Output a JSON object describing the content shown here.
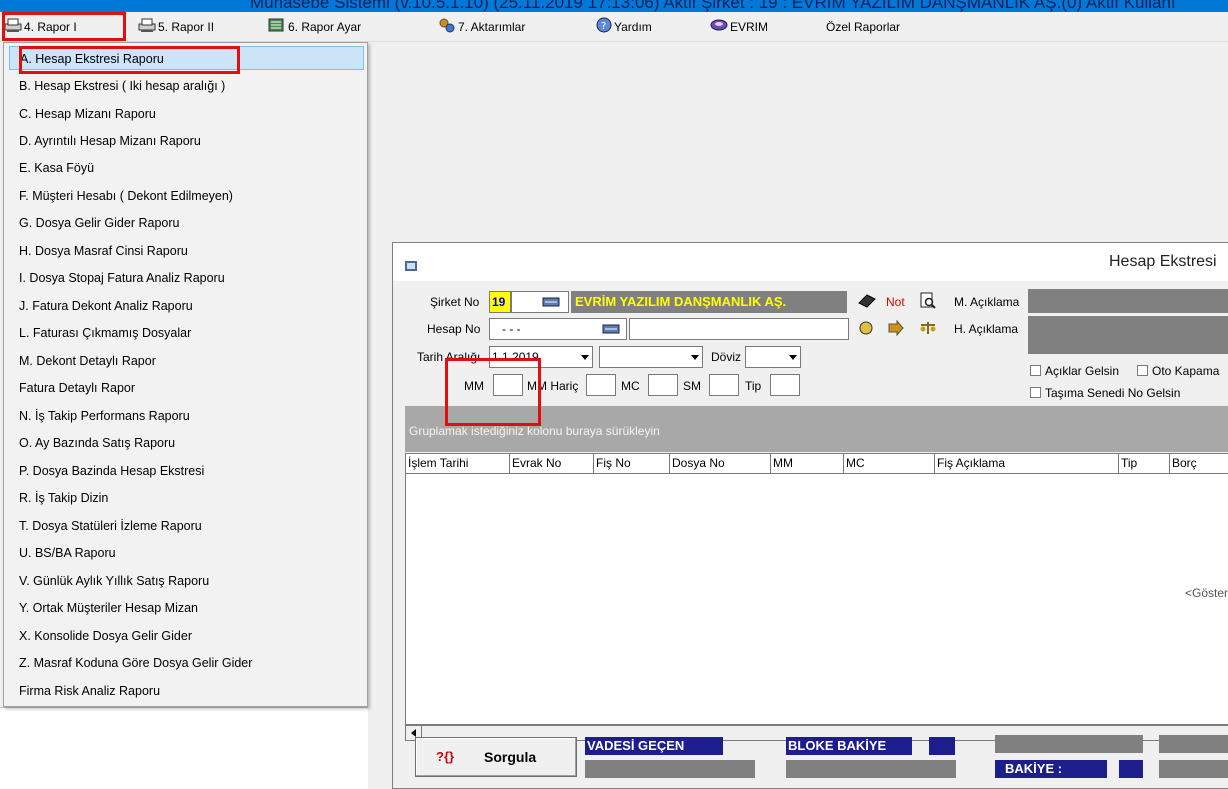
{
  "app": {
    "title": "Muhasebe Sistemi (v.10.5.1.10) (25.11.2019 17:13:06) Aktif Şirket : 19 : EVRIM YAZILIM DANŞMANLIK AŞ.(0) Aktif Kullanı"
  },
  "menubar": {
    "items": [
      {
        "label": "4.  Rapor I",
        "icon": "printer-icon"
      },
      {
        "label": "5.  Rapor II",
        "icon": "printer-icon"
      },
      {
        "label": "6.  Rapor Ayar",
        "icon": "report-settings-icon"
      },
      {
        "label": "7.  Aktarımlar",
        "icon": "transfer-icon"
      },
      {
        "label": "Yardım",
        "icon": "help-icon"
      },
      {
        "label": "EVRIM",
        "icon": "evrim-logo-icon"
      },
      {
        "label": "Özel Raporlar",
        "icon": ""
      }
    ]
  },
  "dropdown": {
    "items": [
      "A.  Hesap Ekstresi Raporu",
      "B.  Hesap Ekstresi ( Iki hesap aralığı )",
      "C.  Hesap Mizanı Raporu",
      "D.  Ayrıntılı Hesap Mizanı Raporu",
      "E.  Kasa Föyü",
      "F.  Müşteri Hesabı ( Dekont Edilmeyen)",
      "G.  Dosya Gelir Gider Raporu",
      "H.  Dosya Masraf Cinsi Raporu",
      "I.  Dosya Stopaj Fatura Analiz Raporu",
      "J.  Fatura Dekont Analiz Raporu",
      "L.  Faturası Çıkmamış Dosyalar",
      "M.   Dekont Detaylı Rapor",
      "       Fatura Detaylı Rapor",
      "N.  İş Takip Performans Raporu",
      "O.  Ay Bazında Satış Raporu",
      "P.  Dosya Bazinda Hesap Ekstresi",
      "R.  İş Takip Dizin",
      "T.  Dosya Statüleri İzleme Raporu",
      "U.  BS/BA Raporu",
      "V. Günlük Aylık Yıllık Satış Raporu",
      "Y. Ortak Müşteriler Hesap Mizan",
      "X. Konsolide Dosya Gelir Gider",
      "Z. Masraf Koduna Göre Dosya Gelir Gider",
      "     Firma Risk Analiz Raporu"
    ],
    "selected_index": 0
  },
  "window": {
    "title": "Hesap Ekstresi",
    "sirket_no_label": "Şirket No",
    "sirket_no_value": "19",
    "company_name": "EVRİM YAZILIM DANŞMANLIK AŞ.",
    "not_label": "Not",
    "m_aciklama_label": "M. Açıklama",
    "hesap_no_label": "Hesap No",
    "hesap_no_value": "- - -",
    "h_aciklama_label": "H. Açıklama",
    "tarih_araligi_label": "Tarih Aralığı",
    "tarih_start": "1.1.2019",
    "doviz_label": "Döviz",
    "mm_label": "MM",
    "mm_haric_label": "MM Hariç",
    "mc_label": "MC",
    "sm_label": "SM",
    "tip_label": "Tip",
    "aciklar_gelsin": "Açıklar Gelsin",
    "oto_kapama": "Oto Kapama",
    "tasima_senedi": "Taşıma Senedi No Gelsin",
    "group_hint": "Gruplamak istediğiniz kolonu buraya sürükleyin",
    "columns": [
      "İşlem Tarihi",
      "Evrak No",
      "Fiş No",
      "Dosya No",
      "MM",
      "MC",
      "Fiş Açıklama",
      "Tip",
      "Borç"
    ],
    "empty_hint": "<Göster",
    "sorgula_icon": "?{}",
    "sorgula_label": "Sorgula",
    "vadesi_gecen": "VADESİ GEÇEN",
    "bloke_bakiye": "BLOKE BAKİYE",
    "bakiye": "BAKİYE    :"
  }
}
